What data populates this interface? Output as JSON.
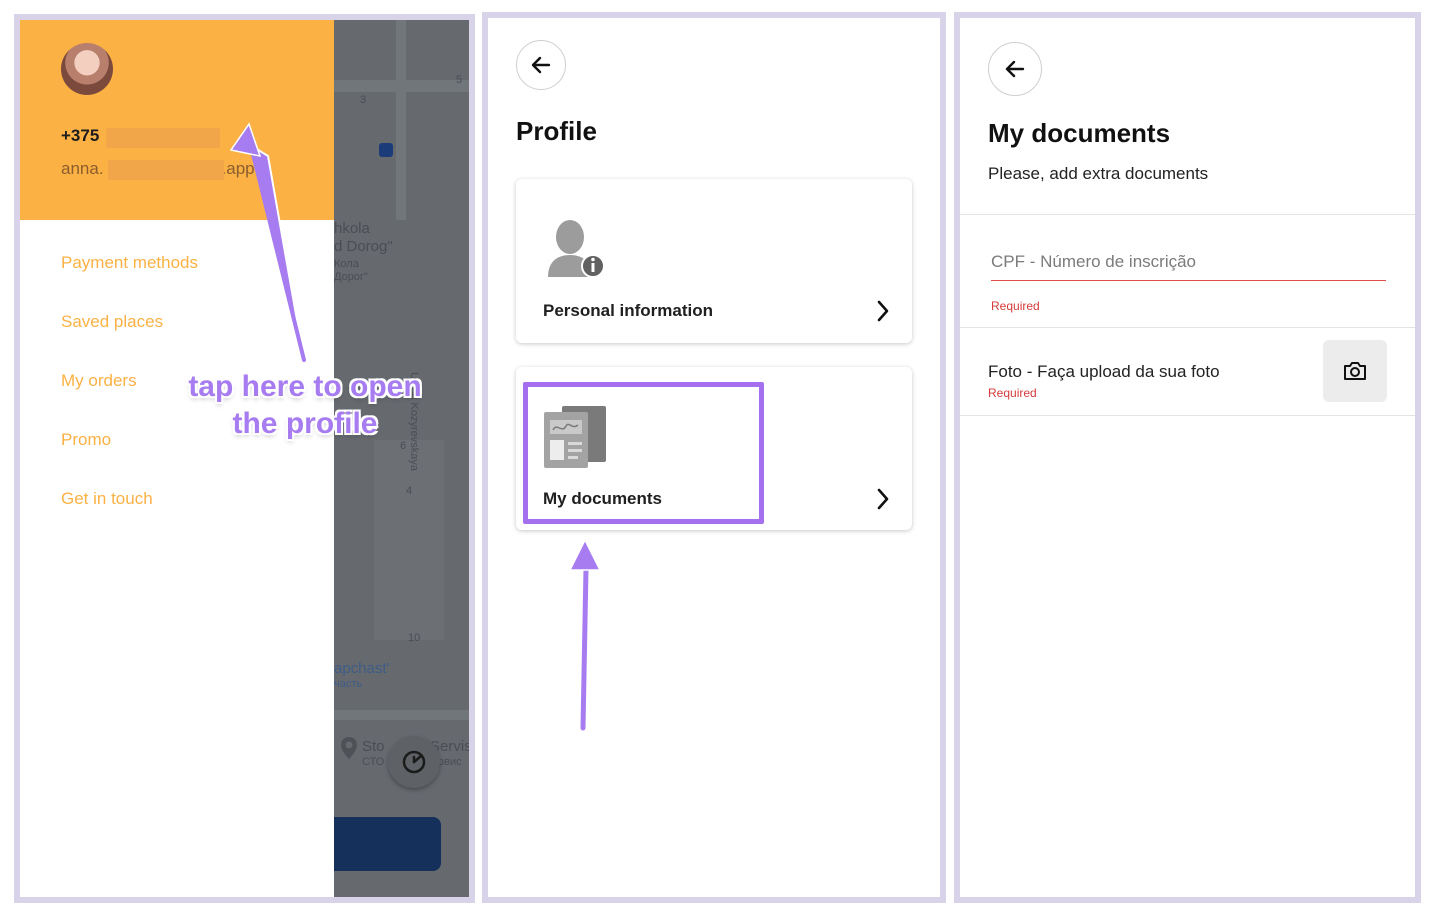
{
  "drawer": {
    "phone": "+375",
    "email_prefix": "anna.",
    "email_suffix": ".app",
    "menu": [
      {
        "label": "Payment methods"
      },
      {
        "label": "Saved places"
      },
      {
        "label": "My orders"
      },
      {
        "label": "Promo"
      },
      {
        "label": "Get in touch"
      }
    ],
    "annotation_line1": "tap here to open",
    "annotation_line2": "the profile"
  },
  "map": {
    "labels": [
      "3",
      "5",
      "hkola",
      "d Dorog\"",
      "Кола",
      "Дорог\"",
      "Ulitsa Kozyrevskaya",
      "6",
      "4",
      "10",
      "apchast'",
      "часть",
      "Sto",
      "Servis",
      "СТО",
      "рвис"
    ]
  },
  "profile": {
    "title": "Profile",
    "cards": [
      {
        "label": "Personal information"
      },
      {
        "label": "My documents"
      }
    ]
  },
  "documents": {
    "title": "My documents",
    "subtitle": "Please, add extra documents",
    "cpf_placeholder": "CPF - Número de inscrição",
    "cpf_error": "Required",
    "photo_label": "Foto - Faça upload da sua foto",
    "photo_error": "Required"
  },
  "colors": {
    "drawer_header": "#fcb145",
    "menu_text": "#fcb145",
    "highlight": "#a570f0",
    "error": "#d63a3a",
    "panel_border": "#d9d3ea"
  },
  "icons": [
    "avatar",
    "back-arrow-icon",
    "person-info-icon",
    "documents-icon",
    "chevron-right-icon",
    "camera-icon",
    "timer-icon",
    "transit-icon",
    "location-pin-icon"
  ]
}
